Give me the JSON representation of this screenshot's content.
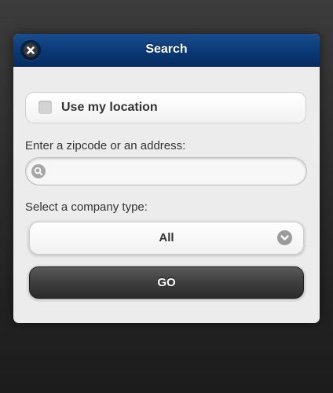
{
  "dialog": {
    "title": "Search",
    "close_icon": "close-icon",
    "header_color": "#0b3a78"
  },
  "location": {
    "label": "Use my location",
    "checked": false
  },
  "address": {
    "label": "Enter a zipcode or an address:",
    "value": "",
    "placeholder": "",
    "icon": "search-icon"
  },
  "company_type": {
    "label": "Select a company type:",
    "selected": "All",
    "icon": "chevron-down-icon"
  },
  "go_button": {
    "label": "GO"
  }
}
